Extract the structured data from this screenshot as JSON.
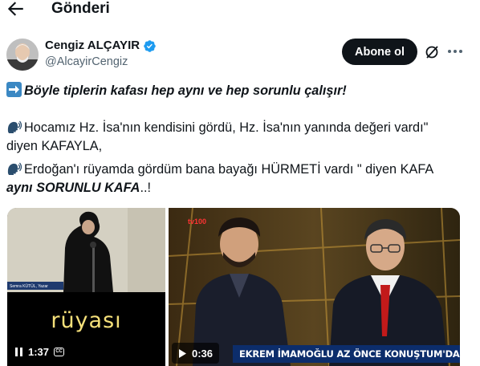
{
  "header": {
    "title": "Gönderi",
    "back_icon": "arrow-left-icon"
  },
  "author": {
    "name": "Cengiz ALÇAYIR",
    "handle": "@AlcayirCengiz",
    "verified_icon": "verified-badge-icon",
    "follow_label": "Abone ol",
    "grok_icon": "grok-icon",
    "more_icon": "more-horizontal-icon"
  },
  "tweet": {
    "line1_text": "Böyle tiplerin kafası hep aynı ve hep sorunlu çalışır!",
    "line2": "Hocamız Hz. İsa'nın kendisini gördü, Hz. İsa'nın yanında değeri vardı\"",
    "line3": "diyen KAFAYLA,",
    "line4": "Erdoğan'ı rüyamda gördüm bana bayağı HÜRMETİ vardı \" diyen KAFA",
    "line5_bold": "aynı SORUNLU KAFA",
    "line5_rest": "..!"
  },
  "media": [
    {
      "caption": "rüyası",
      "duration": "1:37",
      "lower_third": "Semra KÜTÜL, Yazar",
      "cc_label": "CC"
    },
    {
      "duration": "0:36",
      "ticker": "EKREM İMAMOĞLU AZ ÖNCE KONUŞTUM'DA",
      "channel_logo": "tv100"
    }
  ],
  "colors": {
    "text": "#0f1419",
    "secondary": "#536471",
    "verified": "#1d9bf0",
    "follow_bg": "#0f1419",
    "caption_yellow": "#f5e07a",
    "ticker_blue": "#0c2d6b"
  }
}
